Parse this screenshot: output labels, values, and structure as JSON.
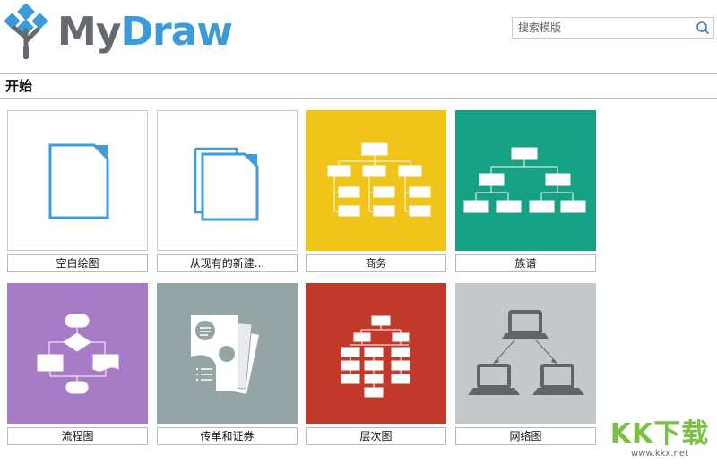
{
  "app": {
    "brand_my": "My",
    "brand_draw": "Draw"
  },
  "search": {
    "placeholder": "搜索模版",
    "icon": "search-icon"
  },
  "section": {
    "title": "开始"
  },
  "tiles": [
    {
      "label": "空白绘图",
      "icon": "blank-document-icon",
      "color": "#ffffff"
    },
    {
      "label": "从现有的新建...",
      "icon": "copy-documents-icon",
      "color": "#ffffff"
    },
    {
      "label": "商务",
      "icon": "org-chart-icon",
      "color": "#f0c419"
    },
    {
      "label": "族谱",
      "icon": "family-tree-icon",
      "color": "#16a084"
    },
    {
      "label": "流程图",
      "icon": "flowchart-icon",
      "color": "#a77bc6"
    },
    {
      "label": "传单和证券",
      "icon": "flyer-icon",
      "color": "#95a5a6"
    },
    {
      "label": "层次图",
      "icon": "hierarchy-icon",
      "color": "#c0392b"
    },
    {
      "label": "网络图",
      "icon": "network-icon",
      "color": "#c4c8c9"
    }
  ],
  "watermark": {
    "text": "KK下载",
    "url": "www.kkx.net"
  }
}
